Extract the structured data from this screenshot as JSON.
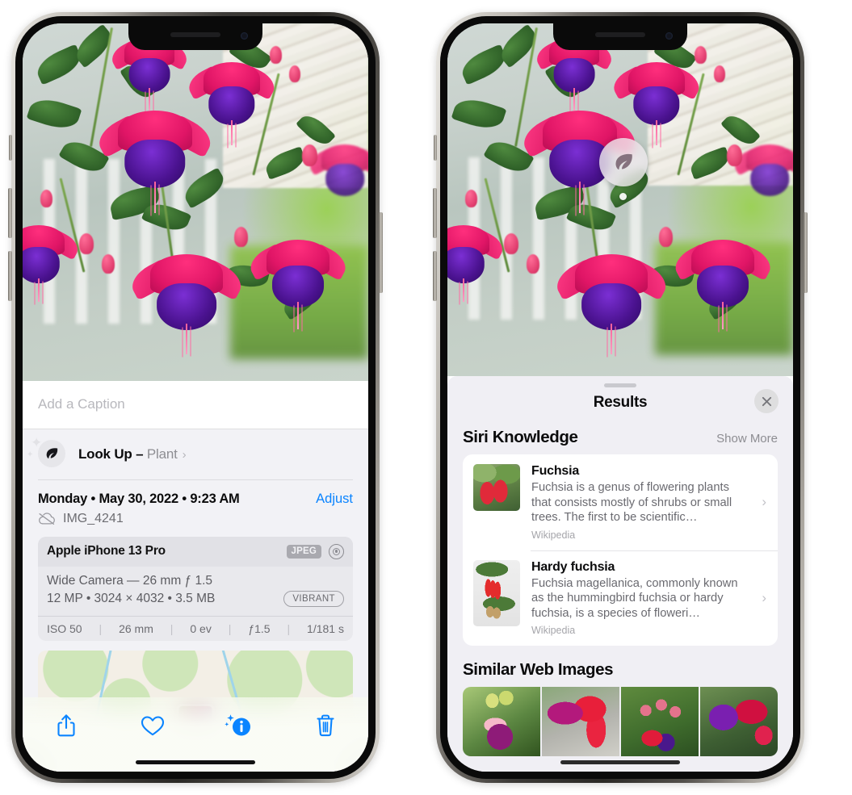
{
  "left_phone": {
    "name": "photos-detail-screen",
    "caption": {
      "placeholder": "Add a Caption",
      "value": ""
    },
    "lookup": {
      "icon": "leaf-icon",
      "label": "Look Up",
      "dash": " – ",
      "subject": "Plant",
      "chevron": "›"
    },
    "date": {
      "weekday": "Monday",
      "full": "Monday • May 30, 2022 • 9:23 AM",
      "adjust_label": "Adjust"
    },
    "file": {
      "icon": "cloud-slash-icon",
      "name": "IMG_4241"
    },
    "camera_card": {
      "model": "Apple iPhone 13 Pro",
      "format_badge": "JPEG",
      "aperture_icon": "aperture-icon",
      "lens_line": "Wide Camera — 26 mm ƒ 1.5",
      "size_line": "12 MP • 3024 × 4032 • 3.5 MB",
      "style_badge": "VIBRANT",
      "exif": [
        {
          "label": "ISO 50"
        },
        {
          "label": "26 mm"
        },
        {
          "label": "0 ev"
        },
        {
          "label": "ƒ1.5"
        },
        {
          "label": "1/181 s"
        }
      ]
    },
    "toolbar": [
      {
        "name": "share-button",
        "icon": "share-icon"
      },
      {
        "name": "favorite-button",
        "icon": "heart-icon"
      },
      {
        "name": "info-button",
        "icon": "info-sparkle-icon"
      },
      {
        "name": "delete-button",
        "icon": "trash-icon"
      }
    ],
    "accent_color": "#0a84ff"
  },
  "right_phone": {
    "name": "visual-lookup-results-screen",
    "badge": {
      "icon": "leaf-icon",
      "name": "visual-lookup-badge"
    },
    "sheet": {
      "title": "Results",
      "close_icon": "close-icon",
      "sections": [
        {
          "title": "Siri Knowledge",
          "action": "Show More",
          "results": [
            {
              "title": "Fuchsia",
              "description": "Fuchsia is a genus of flowering plants that consists mostly of shrubs or small trees. The first to be scientific…",
              "source": "Wikipedia",
              "chevron": "›"
            },
            {
              "title": "Hardy fuchsia",
              "description": "Fuchsia magellanica, commonly known as the hummingbird fuchsia or hardy fuchsia, is a species of floweri…",
              "source": "Wikipedia",
              "chevron": "›"
            }
          ]
        },
        {
          "title": "Similar Web Images",
          "images": [
            {
              "alt": "fuchsia-thumb-1"
            },
            {
              "alt": "fuchsia-thumb-2"
            },
            {
              "alt": "fuchsia-thumb-3"
            },
            {
              "alt": "fuchsia-thumb-4"
            }
          ]
        }
      ]
    }
  }
}
